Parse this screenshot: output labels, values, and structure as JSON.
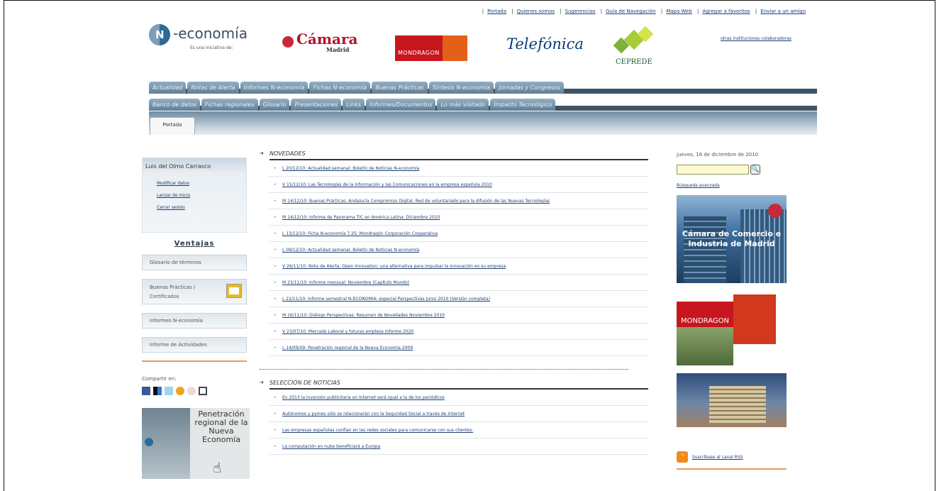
{
  "top_links": [
    "Portada",
    "Quienes somos",
    "Sugerencias",
    "Guía de Navegación",
    "Mapa Web",
    "Agregar a favoritos",
    "Enviar a un amigo"
  ],
  "brand": {
    "logo_word": "-economía",
    "logo_tag": "Es una iniciativa de:",
    "camara_name": "Cámara",
    "camara_sub": "Madrid",
    "mondragon": "MONDRAGON",
    "telefonica": "Telefónica",
    "ceprede": "CEPREDE",
    "other_institutions": "otras instituciones colaboradoras"
  },
  "nav_primary": [
    "Actualidad",
    "Notas de Alerta",
    "Informes N-economía",
    "Fichas N-economía",
    "Buenas Prácticas",
    "Síntesis N-economía",
    "Jornadas y Congresos"
  ],
  "nav_secondary": [
    "Banco de datos",
    "Fichas regionales",
    "Glosario",
    "Presentaciones",
    "Links",
    "Informes/Documentos",
    "Lo más visitado",
    "Impacto Tecnológico"
  ],
  "subtab": "Portada",
  "user": {
    "name": "Luis del Olmo Carrasco",
    "links": [
      "Modificar datos",
      "Lanzar de Inicio",
      "Cerrar sesión"
    ]
  },
  "ventajas": "Ventajas",
  "left_buttons": [
    "Glosario de términos",
    "Buenas Prácticas / Certificados",
    "Informes N-economía",
    "Informe de Actividades"
  ],
  "share_label": "Compartir en:",
  "promo_title": "Penetración regional de la Nueva Economía",
  "novedades": {
    "title": "NOVEDADES",
    "items": [
      "L 20/12/10: Actualidad semanal: Boletín de Noticias N-economía",
      "V 15/12/10: Las Tecnologías de la Información y las Comunicaciones en la empresa española 2010",
      "M 14/12/10: Buenas Prácticas: Andalucía Compromiso Digital: Red de voluntariado para la difusión de las Nuevas Tecnologías",
      "M 14/12/10: Informe de Panorama TIC en América Latina: Diciembre 2010",
      "L 13/12/10: Ficha N-economía 7.25: Mondragón Corporación Cooperativa",
      "L 09/12/10: Actualidad semanal: Boletín de Noticias N-economía",
      "V 26/11/10: Nota de Alerta: Open Innovation: una alternativa para impulsar la innovación en su empresa",
      "M 23/11/10: Informe mensual: Noviembre (Capítulo Mundo)",
      "L 22/11/10: Informe semestral N-ECONOMIA: especial Perspectivas Junio 2010 (Versión completa)",
      "M 16/11/10: Diálogo Perspectivas: Resumen de Novedades Noviembre 2010",
      "V 23/07/10: Mercado Laboral y futuras empleos Informe 2020",
      "L 14/09/09: Penetración regional de la Nueva Economía 2009"
    ]
  },
  "noticias": {
    "title": "SELECCIÓN DE NOTICIAS",
    "items": [
      "En 2013 la inversión publicitaria en Internet será igual a la de los periódicos",
      "Autónomos y pymes sólo se relacionarán con la Seguridad Social a través de Internet",
      "Las empresas españolas confían en las redes sociales para comunicarse con sus clientes.",
      "La computación en nube beneficiará a Europa"
    ]
  },
  "right": {
    "date": "jueves, 16 de diciembre de 2010",
    "search_value": "",
    "search_placeholder": "",
    "advanced_search": "Búsqueda avanzada",
    "ad_camara_text": "Cámara de Comercio e Industria de Madrid",
    "ad_mondragon_text": "MONDRAGON",
    "rss": "Suscríbase al canal RSS"
  }
}
